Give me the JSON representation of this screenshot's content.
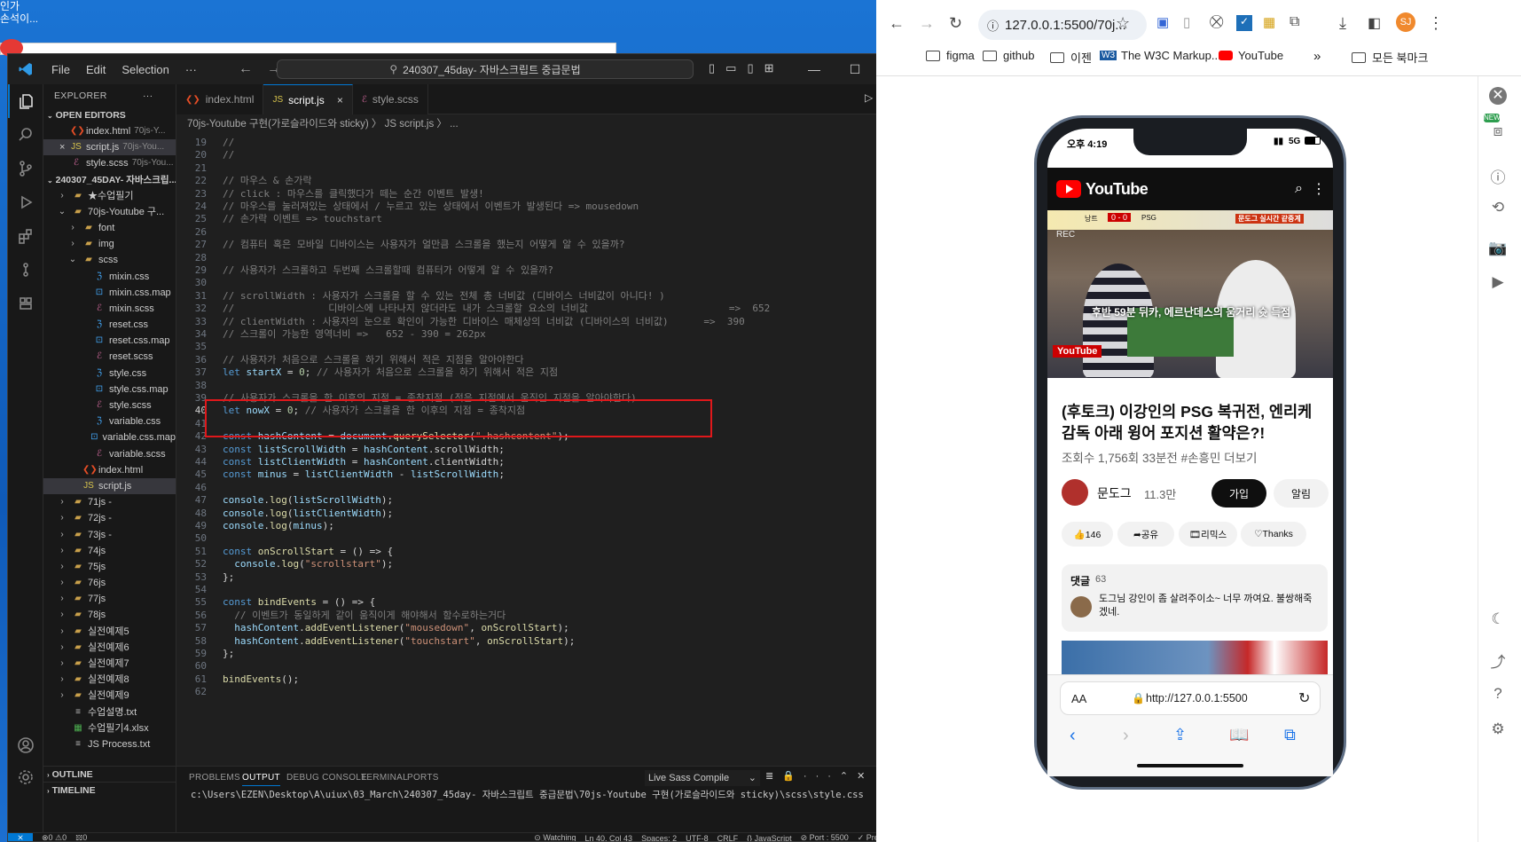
{
  "desktop": {
    "text": "인가\n손석이..."
  },
  "vscode": {
    "menus": [
      "File",
      "Edit",
      "Selection",
      "···"
    ],
    "search": "240307_45day- 자바스크립트 중급문법",
    "explorer_title": "EXPLORER",
    "open_editors_title": "OPEN EDITORS",
    "open_editors": [
      {
        "name": "index.html",
        "hint": "70js-Y...",
        "icon": "html"
      },
      {
        "name": "script.js",
        "hint": "70js-You...",
        "icon": "js",
        "close": "×"
      },
      {
        "name": "style.scss",
        "hint": "70js-You...",
        "icon": "scss"
      }
    ],
    "root_folder": "240307_45DAY- 자바스크립...",
    "tree": [
      {
        "label": "★수업필기",
        "depth": 1,
        "type": "folder"
      },
      {
        "label": "70js-Youtube 구...",
        "depth": 1,
        "type": "folder-open"
      },
      {
        "label": "font",
        "depth": 2,
        "type": "folder"
      },
      {
        "label": "img",
        "depth": 2,
        "type": "folder"
      },
      {
        "label": "scss",
        "depth": 2,
        "type": "folder-open"
      },
      {
        "label": "mixin.css",
        "depth": 3,
        "type": "css"
      },
      {
        "label": "mixin.css.map",
        "depth": 3,
        "type": "map"
      },
      {
        "label": "mixin.scss",
        "depth": 3,
        "type": "scss"
      },
      {
        "label": "reset.css",
        "depth": 3,
        "type": "css"
      },
      {
        "label": "reset.css.map",
        "depth": 3,
        "type": "map"
      },
      {
        "label": "reset.scss",
        "depth": 3,
        "type": "scss"
      },
      {
        "label": "style.css",
        "depth": 3,
        "type": "css"
      },
      {
        "label": "style.css.map",
        "depth": 3,
        "type": "map"
      },
      {
        "label": "style.scss",
        "depth": 3,
        "type": "scss"
      },
      {
        "label": "variable.css",
        "depth": 3,
        "type": "css"
      },
      {
        "label": "variable.css.map",
        "depth": 3,
        "type": "map"
      },
      {
        "label": "variable.scss",
        "depth": 3,
        "type": "scss"
      },
      {
        "label": "index.html",
        "depth": 2,
        "type": "html"
      },
      {
        "label": "script.js",
        "depth": 2,
        "type": "js",
        "selected": true
      },
      {
        "label": "71js -",
        "depth": 1,
        "type": "folder"
      },
      {
        "label": "72js -",
        "depth": 1,
        "type": "folder"
      },
      {
        "label": "73js -",
        "depth": 1,
        "type": "folder"
      },
      {
        "label": "74js",
        "depth": 1,
        "type": "folder"
      },
      {
        "label": "75js",
        "depth": 1,
        "type": "folder"
      },
      {
        "label": "76js",
        "depth": 1,
        "type": "folder"
      },
      {
        "label": "77js",
        "depth": 1,
        "type": "folder"
      },
      {
        "label": "78js",
        "depth": 1,
        "type": "folder"
      },
      {
        "label": "실전예제5",
        "depth": 1,
        "type": "folder"
      },
      {
        "label": "실전예제6",
        "depth": 1,
        "type": "folder"
      },
      {
        "label": "실전예제7",
        "depth": 1,
        "type": "folder"
      },
      {
        "label": "실전예제8",
        "depth": 1,
        "type": "folder"
      },
      {
        "label": "실전예제9",
        "depth": 1,
        "type": "folder"
      },
      {
        "label": "수업설명.txt",
        "depth": 1,
        "type": "txt"
      },
      {
        "label": "수업필기4.xlsx",
        "depth": 1,
        "type": "xlsx"
      },
      {
        "label": "JS Process.txt",
        "depth": 1,
        "type": "txt"
      }
    ],
    "outline_title": "OUTLINE",
    "timeline_title": "TIMELINE",
    "tabs": [
      {
        "label": "index.html",
        "icon": "html"
      },
      {
        "label": "script.js",
        "icon": "js",
        "active": true,
        "close": "×"
      },
      {
        "label": "style.scss",
        "icon": "scss"
      }
    ],
    "breadcrumb": "70js-Youtube 구현(가로슬라이드와 sticky) 〉 JS script.js 〉 ...",
    "code_lines": [
      {
        "n": "19",
        "t": "//",
        "k": "com"
      },
      {
        "n": "20",
        "t": "//",
        "k": "com"
      },
      {
        "n": "21",
        "t": "",
        "k": "com"
      },
      {
        "n": "22",
        "t": "// 마우스 & 손가락",
        "k": "com"
      },
      {
        "n": "23",
        "t": "// click : 마우스를 클릭했다가 떼는 순간 이벤트 발생!",
        "k": "com"
      },
      {
        "n": "24",
        "t": "// 마우스를 눌러져있는 상태에서 / 누르고 있는 상태에서 이벤트가 발생된다 => mousedown",
        "k": "com"
      },
      {
        "n": "25",
        "t": "// 손가락 이벤트 => touchstart",
        "k": "com"
      },
      {
        "n": "26",
        "t": "",
        "k": "com"
      },
      {
        "n": "27",
        "t": "// 컴퓨터 혹은 모바일 디바이스는 사용자가 얼만큼 스크롤을 했는지 어떻게 알 수 있을까?",
        "k": "com"
      },
      {
        "n": "28",
        "t": "",
        "k": "com"
      },
      {
        "n": "29",
        "t": "// 사용자가 스크롤하고 두번째 스크롤할때 컴퓨터가 어떻게 알 수 있을까?",
        "k": "com"
      },
      {
        "n": "30",
        "t": "",
        "k": "com"
      },
      {
        "n": "31",
        "t": "// scrollWidth : 사용자가 스크롤을 할 수 있는 전체 총 너비값 (디바이스 너비값이 아니다! )",
        "k": "com"
      },
      {
        "n": "32",
        "t": "//                디바이스에 나타나지 않더라도 내가 스크롤할 요소의 너비값                        =>  652",
        "k": "com"
      },
      {
        "n": "33",
        "t": "// clientWidth : 사용자의 눈으로 확인이 가능한 디바이스 매체상의 너비값 (디바이스의 너비값)      =>  390",
        "k": "com"
      },
      {
        "n": "34",
        "t": "// 스크롤이 가능한 영역너비 =>   652 - 390 = 262px",
        "k": "com"
      },
      {
        "n": "35",
        "t": "",
        "k": "com"
      },
      {
        "n": "36",
        "t": "// 사용자가 처음으로 스크롤을 하기 위해서 적은 지점을 알아야한다",
        "k": "com"
      },
      {
        "n": "37",
        "t": "let startX = 0; // 사용자가 처음으로 스크롤을 하기 위해서 적은 지점",
        "k": "let"
      },
      {
        "n": "38",
        "t": "",
        "k": "com"
      },
      {
        "n": "39",
        "t": "// 사용자가 스크롤을 한 이후의 지점 = 종착지점 (적은 지점에서 움직인 지점을 알아야한다)",
        "k": "com"
      },
      {
        "n": "40",
        "t": "let nowX = 0; // 사용자가 스크롤을 한 이후의 지점 = 종착지점",
        "k": "let"
      },
      {
        "n": "41",
        "t": "",
        "k": "com"
      },
      {
        "n": "42",
        "t": "const hashContent = document.querySelector(\".hashcontent\");",
        "k": "code"
      },
      {
        "n": "43",
        "t": "const listScrollWidth = hashContent.scrollWidth;",
        "k": "code"
      },
      {
        "n": "44",
        "t": "const listClientWidth = hashContent.clientWidth;",
        "k": "code"
      },
      {
        "n": "45",
        "t": "const minus = listClientWidth - listScrollWidth;",
        "k": "code"
      },
      {
        "n": "46",
        "t": "",
        "k": "com"
      },
      {
        "n": "47",
        "t": "console.log(listScrollWidth);",
        "k": "code"
      },
      {
        "n": "48",
        "t": "console.log(listClientWidth);",
        "k": "code"
      },
      {
        "n": "49",
        "t": "console.log(minus);",
        "k": "code"
      },
      {
        "n": "50",
        "t": "",
        "k": "com"
      },
      {
        "n": "51",
        "t": "const onScrollStart = () => {",
        "k": "code"
      },
      {
        "n": "52",
        "t": "  console.log(\"scrollstart\");",
        "k": "code"
      },
      {
        "n": "53",
        "t": "};",
        "k": "code"
      },
      {
        "n": "54",
        "t": "",
        "k": "com"
      },
      {
        "n": "55",
        "t": "const bindEvents = () => {",
        "k": "code"
      },
      {
        "n": "56",
        "t": "  // 이벤트가 동일하게 같이 움직이게 해야해서 함수로하는거다",
        "k": "com"
      },
      {
        "n": "57",
        "t": "  hashContent.addEventListener(\"mousedown\", onScrollStart);",
        "k": "code"
      },
      {
        "n": "58",
        "t": "  hashContent.addEventListener(\"touchstart\", onScrollStart);",
        "k": "code"
      },
      {
        "n": "59",
        "t": "};",
        "k": "code"
      },
      {
        "n": "60",
        "t": "",
        "k": "com"
      },
      {
        "n": "61",
        "t": "bindEvents();",
        "k": "code"
      },
      {
        "n": "62",
        "t": "",
        "k": "com"
      }
    ],
    "panel_tabs": [
      "PROBLEMS",
      "OUTPUT",
      "DEBUG CONSOLE",
      "TERMINAL",
      "PORTS"
    ],
    "panel_active": "OUTPUT",
    "output_channel": "Live Sass Compile",
    "output_text": "c:\\Users\\EZEN\\Desktop\\A\\uiux\\03_March\\240307_45day- 자바스크립트 중급문법\\70js-Youtube 구현(가로슬라이드와 sticky)\\scss\\style.css",
    "status": {
      "problems": "⊗0 ⚠0",
      "ports": "𝍌0",
      "watching": "⊙ Watching",
      "position": "Ln 40, Col 43",
      "spaces": "Spaces: 2",
      "encoding": "UTF-8",
      "eol": "CRLF",
      "language": "{} JavaScript",
      "port": "⊘ Port : 5500",
      "prettier": "✓ Prettier"
    }
  },
  "chrome": {
    "url": "127.0.0.1:5500/70j...",
    "bookmarks": [
      "figma",
      "github",
      "이젠",
      "The W3C Markup...",
      "YouTube"
    ],
    "more_bookmarks": "모든 북마크",
    "profile_initials": "SJ",
    "rail_badge": "NEW"
  },
  "phone": {
    "time": "오후 4:19",
    "network": "5G",
    "yt_brand": "YouTube",
    "video_overlay": {
      "scoreboard": "0 - 0",
      "team_left": "낭트",
      "team_right": "PSG",
      "badge_right": "문도그 실시간 같중계",
      "caption": "후반 59분 뒤카, 에르난데스의 움거리 슛 득점",
      "rec": "REC",
      "logo": "YouTube"
    },
    "video_title": "(후토크) 이강인의 PSG 복귀전, 엔리케 감독 아래 윙어 포지션 활약은?!",
    "meta": {
      "views": "조회수 1,756회",
      "time": "33분전",
      "tag": "#손흥민",
      "more": "더보기"
    },
    "channel": {
      "name": "문도그",
      "subs": "11.3만"
    },
    "join_btn": "가입",
    "notify_btn": "알림",
    "actions": [
      "👍146",
      "➦공유",
      "🎞리믹스",
      "♡Thanks"
    ],
    "comments": {
      "label": "댓글",
      "count": "63",
      "text": "도그님 강인이 좀 살려주이소~ 너무 까여요. 불쌍해죽겠네."
    },
    "safari": {
      "aa": "AA",
      "url": "http://127.0.0.1:5500"
    }
  }
}
